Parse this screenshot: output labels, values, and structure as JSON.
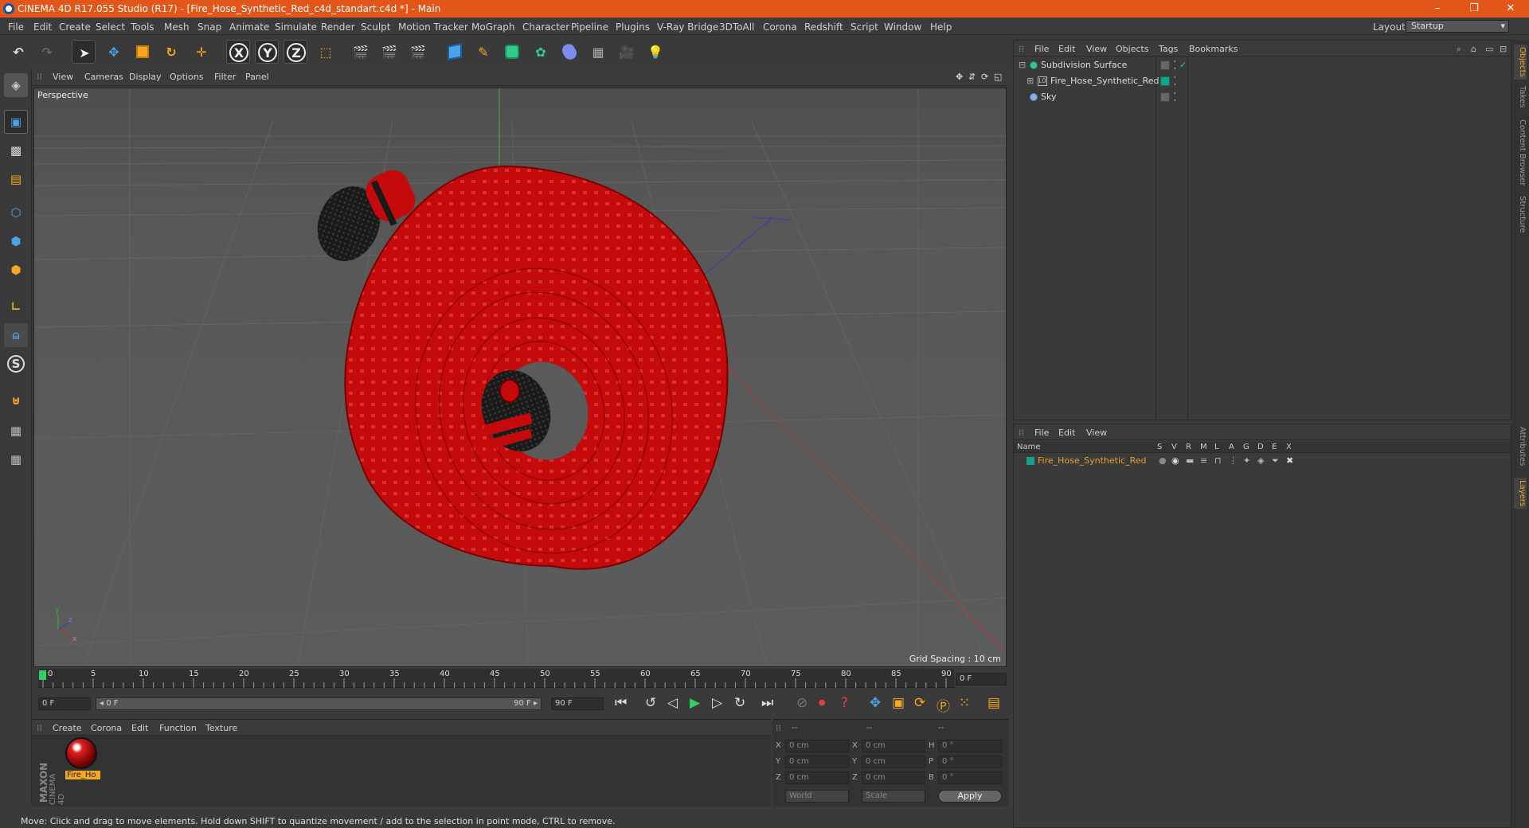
{
  "title": "CINEMA 4D R17.055 Studio (R17) - [Fire_Hose_Synthetic_Red_c4d_standart.c4d *] - Main",
  "window_buttons": [
    "–",
    "❐",
    "✕"
  ],
  "menu": [
    "File",
    "Edit",
    "Create",
    "Select",
    "Tools",
    "Mesh",
    "Snap",
    "Animate",
    "Simulate",
    "Render",
    "Sculpt",
    "Motion Tracker",
    "MoGraph",
    "Character",
    "Pipeline",
    "Plugins",
    "V-Ray Bridge",
    "3DToAll",
    "Corona",
    "Redshift",
    "Script",
    "Window",
    "Help"
  ],
  "layout": {
    "label": "Layout:",
    "value": "Startup"
  },
  "toolbar": {
    "x_label": "X",
    "y_label": "Y",
    "z_label": "Z"
  },
  "left_tools": {
    "snap_label": "S"
  },
  "viewport": {
    "menu": [
      "View",
      "Cameras",
      "Display",
      "Options",
      "Filter",
      "Panel"
    ],
    "label": "Perspective",
    "grid_spacing": "Grid Spacing : 10 cm",
    "axis_labels": {
      "y": "y",
      "z": "z",
      "x": "x"
    }
  },
  "timeline": {
    "ticks": [
      "0",
      "5",
      "10",
      "15",
      "20",
      "25",
      "30",
      "35",
      "40",
      "45",
      "50",
      "55",
      "60",
      "65",
      "70",
      "75",
      "80",
      "85",
      "90"
    ],
    "current_frame": "0 F",
    "start_field": "0 F",
    "range_start": "◂ 0 F",
    "range_end": "90 F ▸",
    "end_field": "90 F"
  },
  "material_panel": {
    "menu": [
      "Create",
      "Corona",
      "Edit",
      "Function",
      "Texture"
    ],
    "material_name": "Fire_Ho",
    "brand": "MAXON",
    "brand_sub": "CINEMA 4D"
  },
  "coords": {
    "header": [
      "--",
      "--",
      "--"
    ],
    "rows": [
      {
        "l1": "X",
        "v1": "0 cm",
        "l2": "X",
        "v2": "0 cm",
        "l3": "H",
        "v3": "0 °"
      },
      {
        "l1": "Y",
        "v1": "0 cm",
        "l2": "Y",
        "v2": "0 cm",
        "l3": "P",
        "v3": "0 °"
      },
      {
        "l1": "Z",
        "v1": "0 cm",
        "l2": "Z",
        "v2": "0 cm",
        "l3": "B",
        "v3": "0 °"
      }
    ],
    "space": "World",
    "mode": "Scale",
    "apply": "Apply"
  },
  "status": "Move: Click and drag to move elements. Hold down SHIFT to quantize movement / add to the selection in point mode, CTRL to remove.",
  "object_manager": {
    "menu": [
      "File",
      "Edit",
      "View",
      "Objects",
      "Tags",
      "Bookmarks"
    ],
    "objects": [
      {
        "name": "Subdivision Surface"
      },
      {
        "name": "Fire_Hose_Synthetic_Red"
      },
      {
        "name": "Sky"
      }
    ]
  },
  "layer_manager": {
    "menu": [
      "File",
      "Edit",
      "View"
    ],
    "name_header": "Name",
    "flag_headers": [
      "S",
      "V",
      "R",
      "M",
      "L",
      "A",
      "G",
      "D",
      "E",
      "X"
    ],
    "layers": [
      {
        "name": "Fire_Hose_Synthetic_Red"
      }
    ]
  },
  "side_tabs": [
    "Objects",
    "Takes",
    "Content Browser",
    "Structure",
    "Attributes",
    "Layers"
  ],
  "colors": {
    "accent": "#e2561a",
    "hose_red": "#c40a0a",
    "layer_name": "#e8a030"
  }
}
